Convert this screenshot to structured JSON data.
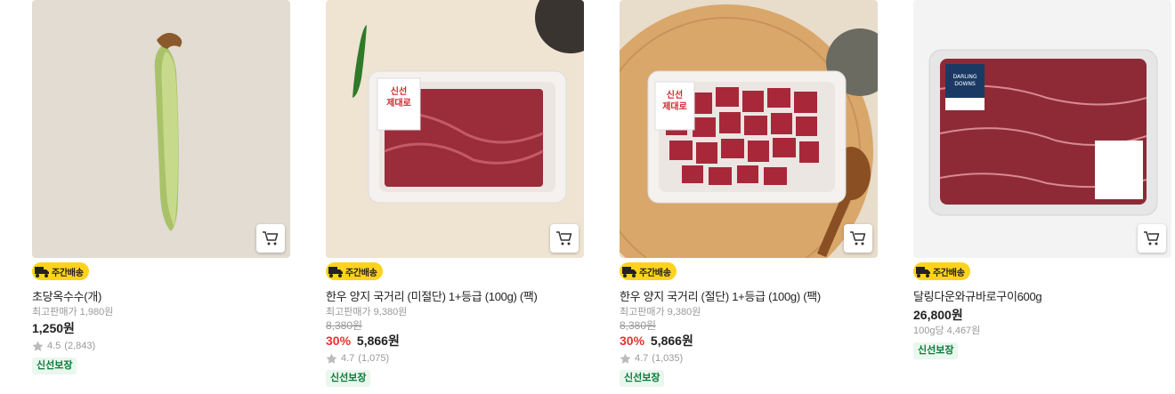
{
  "products": [
    {
      "delivery_badge": "주간배송",
      "name": "초당옥수수(개)",
      "max_price": "최고판매가 1,980원",
      "price": "1,250원",
      "rating": "4.5",
      "review_count": "(2,843)",
      "fresh_label": "신선보장",
      "image_icon": "corn-image"
    },
    {
      "delivery_badge": "주간배송",
      "name": "한우 양지 국거리 (미절단) 1+등급 (100g) (팩)",
      "max_price": "최고판매가 9,380원",
      "original_price": "8,380원",
      "discount": "30%",
      "price": "5,866원",
      "rating": "4.7",
      "review_count": "(1,075)",
      "fresh_label": "신선보장",
      "package_label": "신선\n제대로",
      "image_icon": "beef-slab-image"
    },
    {
      "delivery_badge": "주간배송",
      "name": "한우 양지 국거리 (절단) 1+등급 (100g) (팩)",
      "max_price": "최고판매가 9,380원",
      "original_price": "8,380원",
      "discount": "30%",
      "price": "5,866원",
      "rating": "4.7",
      "review_count": "(1,035)",
      "fresh_label": "신선보장",
      "package_label": "신선\n제대로",
      "image_icon": "beef-cubes-image"
    },
    {
      "delivery_badge": "주간배송",
      "name": "달링다운와규바로구이600g",
      "price": "26,800원",
      "unit_price": "100g당 4,467원",
      "fresh_label": "신선보장",
      "package_label": "DARLING DOWNS",
      "image_icon": "wagyu-pack-image"
    }
  ],
  "colors": {
    "badge_yellow": "#ffd21e",
    "discount_red": "#e3342f",
    "fresh_green": "#0a7a3a"
  }
}
